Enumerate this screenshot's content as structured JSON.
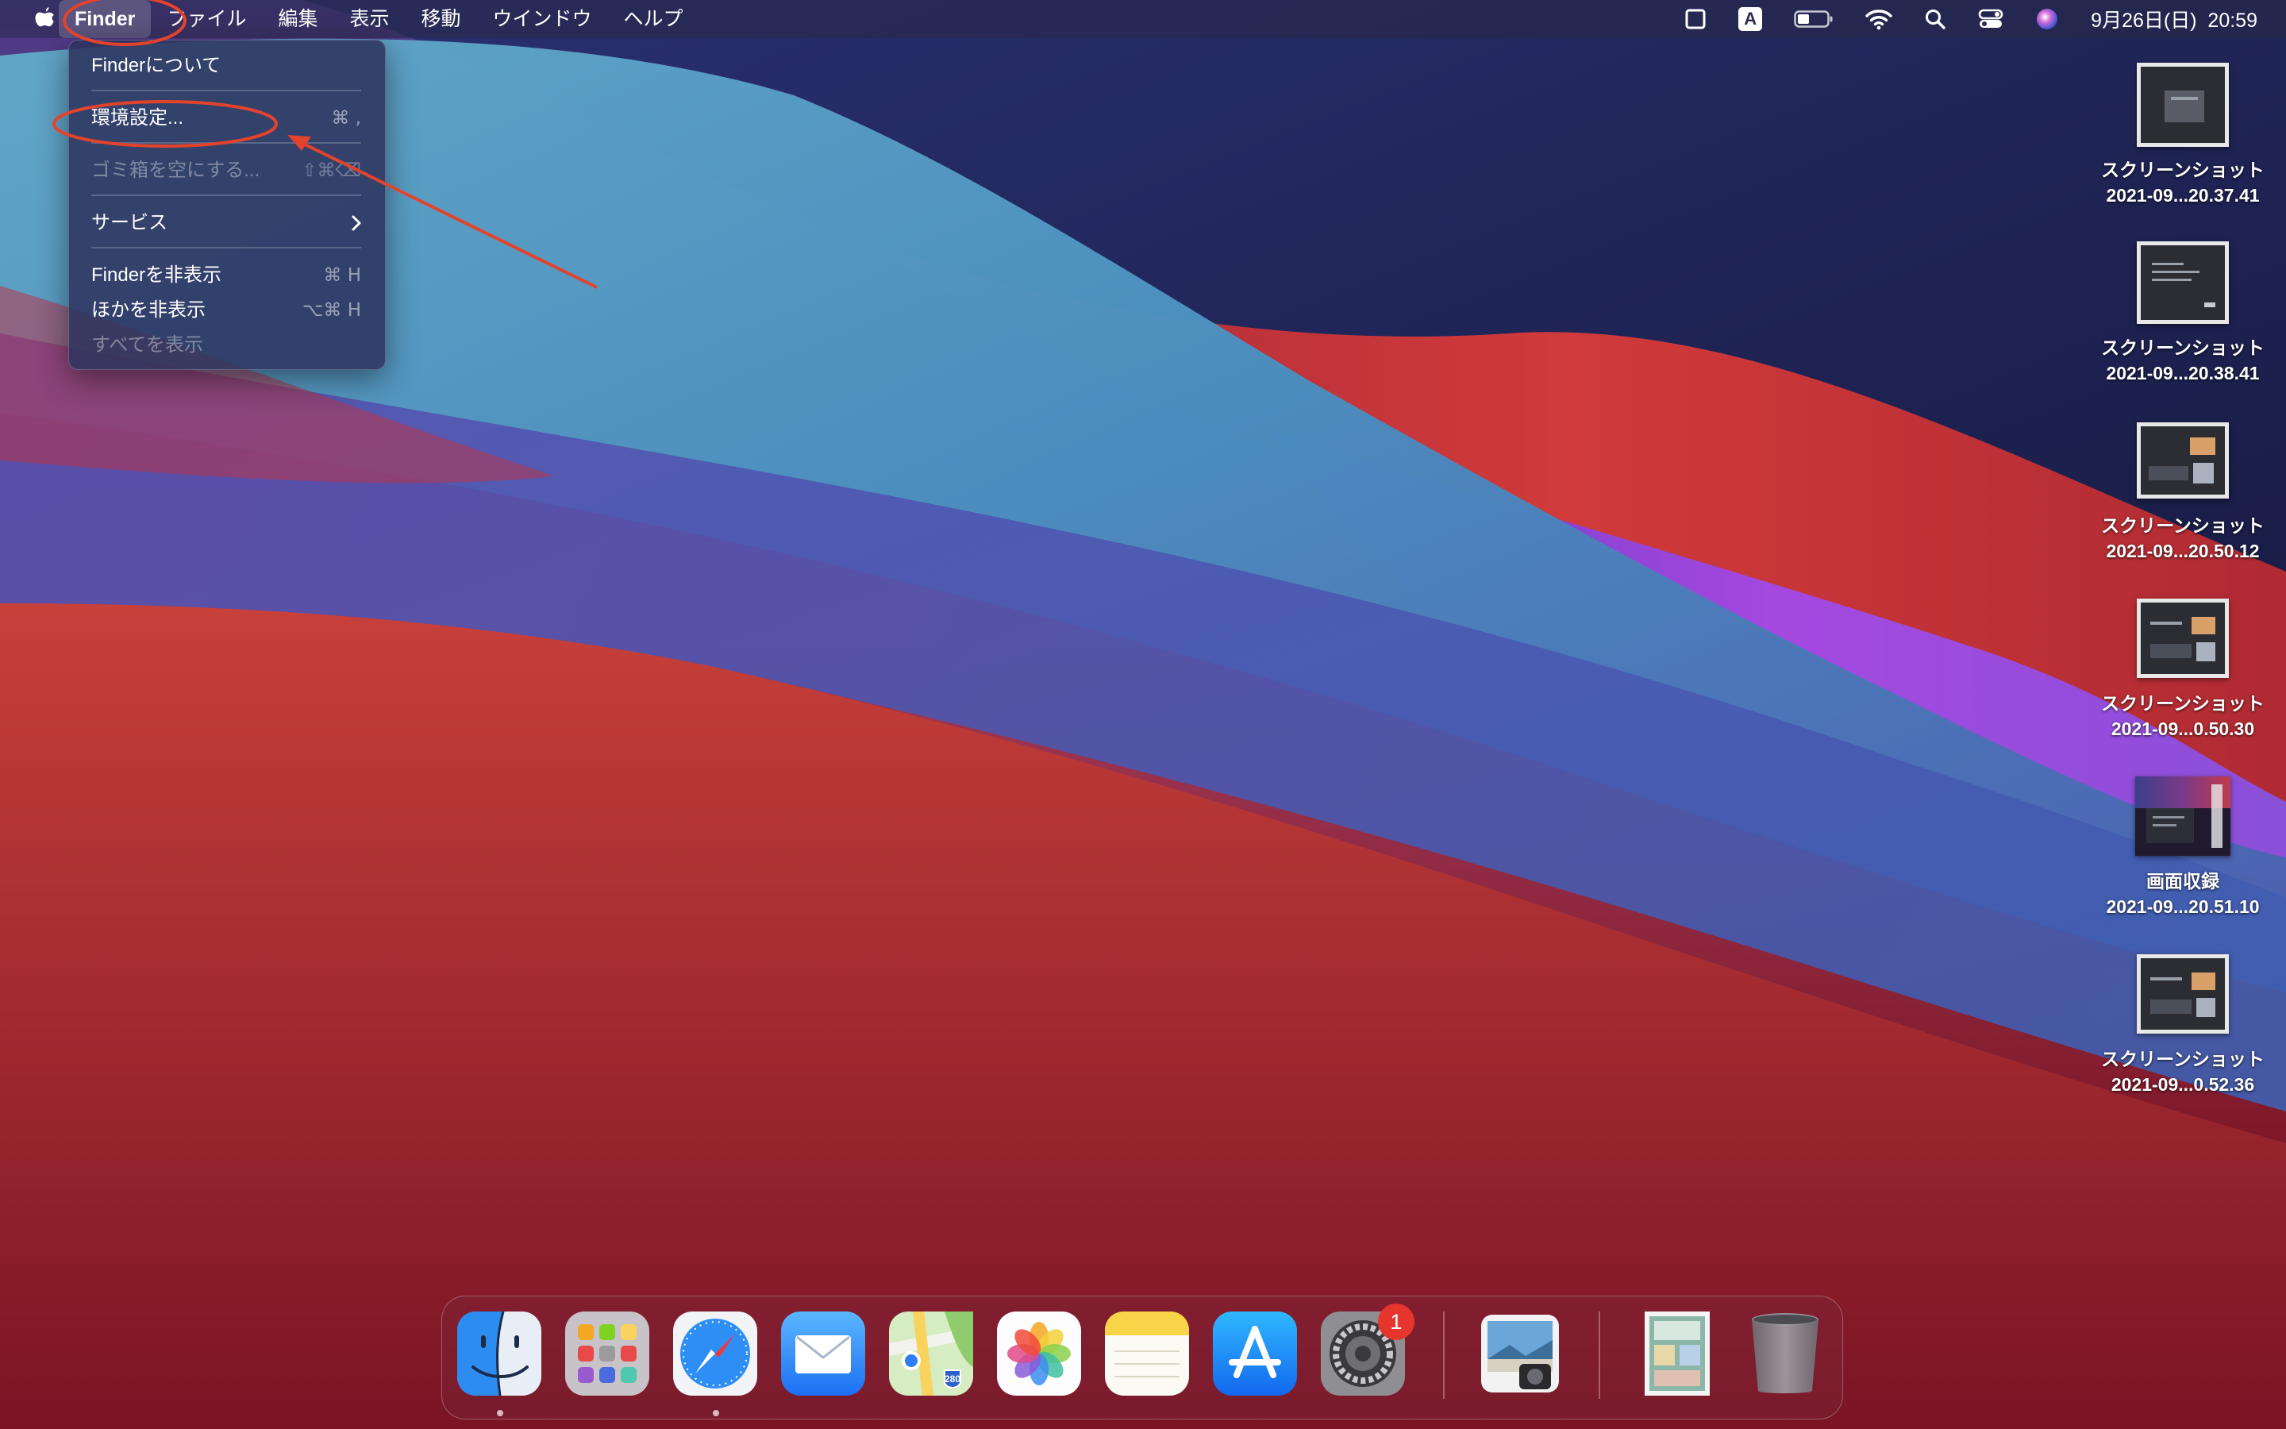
{
  "menubar": {
    "apple_icon": "apple-logo-icon",
    "items": [
      {
        "label": "Finder",
        "active": true
      },
      {
        "label": "ファイル"
      },
      {
        "label": "編集"
      },
      {
        "label": "表示"
      },
      {
        "label": "移動"
      },
      {
        "label": "ウインドウ"
      },
      {
        "label": "ヘルプ"
      }
    ],
    "status": {
      "icons": [
        "screen-mirror-icon",
        "input-method-icon",
        "battery-icon",
        "wifi-icon",
        "search-icon",
        "control-center-icon",
        "siri-icon"
      ],
      "input_method_letter": "A",
      "clock": "9月26日(日)  20:59"
    }
  },
  "finder_menu": {
    "items": [
      {
        "label": "Finderについて",
        "shortcut": "",
        "enabled": true
      },
      {
        "label": "環境設定...",
        "shortcut": "⌘ ,",
        "enabled": true,
        "highlighted_by_annotation": true
      },
      {
        "label": "ゴミ箱を空にする...",
        "shortcut": "⇧⌘⌫",
        "enabled": false
      },
      {
        "label": "サービス",
        "shortcut": "",
        "enabled": true,
        "submenu": true
      },
      {
        "label": "Finderを非表示",
        "shortcut": "⌘ H",
        "enabled": true
      },
      {
        "label": "ほかを非表示",
        "shortcut": "⌥⌘ H",
        "enabled": true
      },
      {
        "label": "すべてを表示",
        "shortcut": "",
        "enabled": false
      }
    ]
  },
  "desktop_icons": [
    {
      "line1": "スクリーンショット",
      "line2": "2021-09...20.37.41",
      "kind": "screenshot"
    },
    {
      "line1": "スクリーンショット",
      "line2": "2021-09...20.38.41",
      "kind": "screenshot"
    },
    {
      "line1": "スクリーンショット",
      "line2": "2021-09...20.50.12",
      "kind": "screenshot"
    },
    {
      "line1": "スクリーンショット",
      "line2": "2021-09...0.50.30",
      "kind": "screenshot"
    },
    {
      "line1": "画面収録",
      "line2": "2021-09...20.51.10",
      "kind": "recording"
    },
    {
      "line1": "スクリーンショット",
      "line2": "2021-09...0.52.36",
      "kind": "screenshot"
    }
  ],
  "dock": {
    "apps": [
      {
        "name": "finder-icon",
        "running": true
      },
      {
        "name": "launchpad-icon",
        "running": false
      },
      {
        "name": "safari-icon",
        "running": true
      },
      {
        "name": "mail-icon",
        "running": false
      },
      {
        "name": "maps-icon",
        "running": false,
        "shield_number": "280"
      },
      {
        "name": "photos-icon",
        "running": false
      },
      {
        "name": "notes-icon",
        "running": false
      },
      {
        "name": "app-store-icon",
        "running": false
      },
      {
        "name": "system-preferences-icon",
        "running": false,
        "badge": "1"
      },
      {
        "name": "preview-icon",
        "running": false
      },
      {
        "name": "downloads-stack-icon",
        "running": false
      },
      {
        "name": "trash-icon",
        "running": false
      }
    ]
  },
  "colors": {
    "annotation_red": "#e2432d",
    "menubar_bg": "rgba(40,40,70,0.55)",
    "menu_bg": "rgba(44,50,92,0.86)",
    "wallpaper_red": "#c23a3a",
    "wallpaper_navy": "#1c1f4a",
    "wallpaper_teal": "#4f9fc4",
    "wallpaper_violet": "#9b4ad8"
  }
}
